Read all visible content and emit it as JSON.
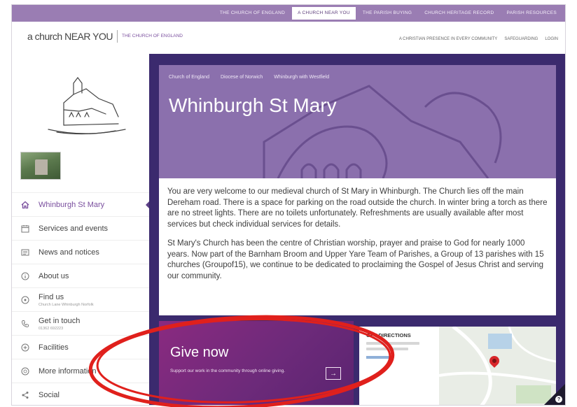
{
  "top_nav": {
    "items": [
      {
        "label": "THE CHURCH OF ENGLAND",
        "active": false
      },
      {
        "label": "A CHURCH NEAR YOU",
        "active": true
      },
      {
        "label": "THE PARISH BUYING",
        "active": false
      },
      {
        "label": "CHURCH HERITAGE RECORD",
        "active": false
      },
      {
        "label": "PARISH RESOURCES",
        "active": false
      }
    ]
  },
  "header": {
    "logo_text": "a church NEAR YOU",
    "logo_coe": "THE CHURCH OF ENGLAND",
    "nav": [
      "A CHRISTIAN PRESENCE IN EVERY COMMUNITY",
      "SAFEGUARDING",
      "LOGIN"
    ]
  },
  "sidebar": {
    "items": [
      {
        "label": "Whinburgh St Mary",
        "sub": "",
        "icon": "home-icon",
        "active": true
      },
      {
        "label": "Services and events",
        "sub": "",
        "icon": "calendar-icon",
        "active": false
      },
      {
        "label": "News and notices",
        "sub": "",
        "icon": "newspaper-icon",
        "active": false
      },
      {
        "label": "About us",
        "sub": "",
        "icon": "info-icon",
        "active": false
      },
      {
        "label": "Find us",
        "sub": "Church Lane Whinburgh Norfolk",
        "icon": "location-icon",
        "active": false
      },
      {
        "label": "Get in touch",
        "sub": "01362 692223",
        "icon": "phone-icon",
        "active": false
      },
      {
        "label": "Facilities",
        "sub": "",
        "icon": "plus-circle-icon",
        "active": false
      },
      {
        "label": "More information",
        "sub": "",
        "icon": "more-info-icon",
        "active": false
      },
      {
        "label": "Social",
        "sub": "",
        "icon": "share-icon",
        "active": false
      }
    ]
  },
  "hero": {
    "breadcrumbs": [
      "Church of England",
      "Diocese of Norwich",
      "Whinburgh with Westfield"
    ],
    "title": "Whinburgh St Mary"
  },
  "content": {
    "paragraphs": [
      "You are very welcome to our medieval church of St Mary in Whinburgh. The Church lies off the main Dereham road. There is a space for parking on the road outside the church. In winter bring a torch as there are no street lights. There are no toilets unfortunately. Refreshments are usually available after most services but check individual services for details.",
      "St Mary's Church has been the centre of Christian worship, prayer and praise to God for nearly 1000 years. Now part of the Barnham Broom and Upper Yare Team of Parishes, a Group of 13 parishes with 15 churches (Groupof15), we continue to be dedicated to proclaiming the Gospel of Jesus Christ and serving our community."
    ]
  },
  "give": {
    "title": "Give now",
    "subtitle": "Support our work in the community through online giving.",
    "arrow": "→"
  },
  "map": {
    "title": "GET DIRECTIONS"
  },
  "colors": {
    "top_bar": "#9a7db3",
    "main_bg": "#3b2a6e",
    "hero_bg": "#8b70ad",
    "give_bg": "#7a2a7e",
    "accent": "#7a4f9e",
    "annotation": "#e0201c"
  }
}
